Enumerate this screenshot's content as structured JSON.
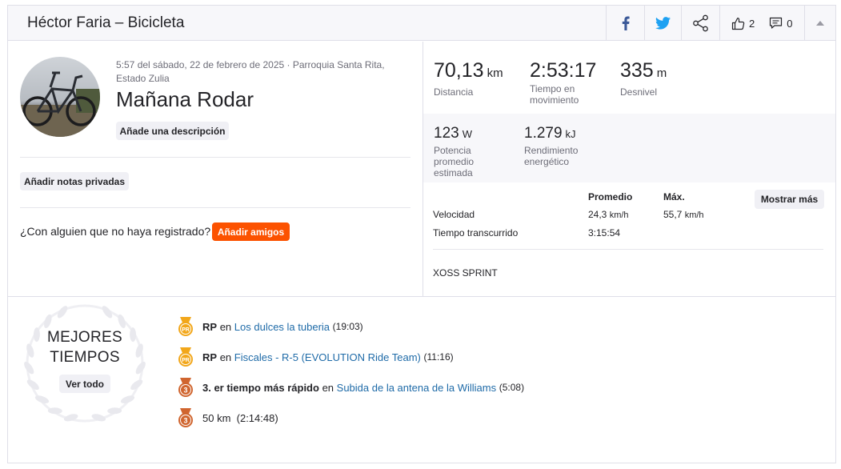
{
  "header": {
    "title": "Héctor Faria – Bicicleta",
    "kudos_count": "2",
    "comments_count": "0"
  },
  "activity": {
    "meta": "5:57 del sábado, 22 de febrero de 2025 · Parroquia Santa Rita, Estado Zulia",
    "name": "Mañana Rodar",
    "add_description_label": "Añade una descripción",
    "add_private_notes_label": "Añadir notas privadas",
    "friends_question": "¿Con alguien que no haya registrado?",
    "add_friends_label": "Añadir amigos"
  },
  "stats": {
    "distance": {
      "value": "70,13",
      "unit": "km",
      "label": "Distancia"
    },
    "moving_time": {
      "value": "2:53:17",
      "label": "Tiempo en movimiento"
    },
    "elevation": {
      "value": "335",
      "unit": "m",
      "label": "Desnivel"
    },
    "power": {
      "value": "123",
      "unit": "W",
      "label": "Potencia promedio estimada"
    },
    "energy": {
      "value": "1.279",
      "unit": "kJ",
      "label": "Rendimiento energético"
    }
  },
  "table": {
    "col_avg": "Promedio",
    "col_max": "Máx.",
    "show_more_label": "Mostrar más",
    "speed_label": "Velocidad",
    "speed_avg": "24,3",
    "speed_avg_unit": "km/h",
    "speed_max": "55,7",
    "speed_max_unit": "km/h",
    "elapsed_label": "Tiempo transcurrido",
    "elapsed_avg": "3:15:54"
  },
  "device": "XOSS SPRINT",
  "best_efforts": {
    "title_line1": "MEJORES",
    "title_line2": "TIEMPOS",
    "view_all_label": "Ver todo",
    "items": [
      {
        "badge": "PR",
        "prefix": "RP",
        "connector": "en",
        "segment": "Los dulces la tuberia",
        "time": "(19:03)"
      },
      {
        "badge": "PR",
        "prefix": "RP",
        "connector": "en",
        "segment": "Fiscales - R-5 (EVOLUTION Ride Team)",
        "time": "(11:16)"
      },
      {
        "badge": "3",
        "prefix": "3. er tiempo más rápido",
        "connector": "en",
        "segment": "Subida de la antena de la Williams",
        "time": "(5:08)"
      },
      {
        "badge": "3",
        "prefix": "50 km",
        "time": "(2:14:48)"
      }
    ]
  },
  "colors": {
    "accent": "#fc5200",
    "link": "#1f6ba8",
    "facebook": "#3b5998",
    "twitter": "#1da1f2",
    "medal_gold": "#f2a71b",
    "medal_bronze": "#d0652f"
  }
}
